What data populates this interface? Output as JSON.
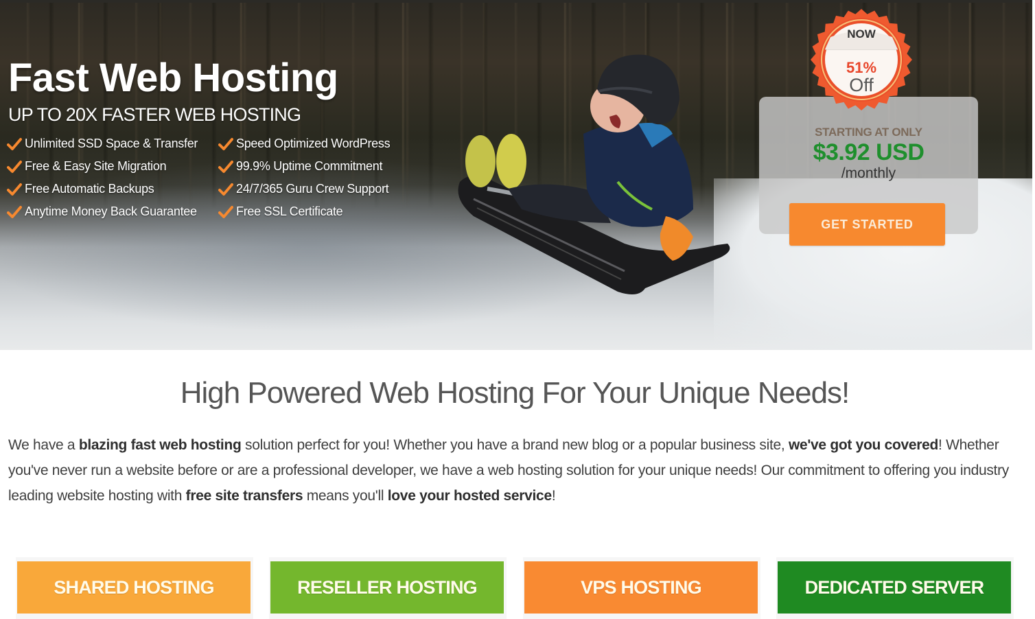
{
  "hero": {
    "title": "Fast Web Hosting",
    "subtitle": "UP TO 20X FASTER WEB HOSTING",
    "features": [
      "Unlimited SSD Space & Transfer",
      "Speed Optimized WordPress",
      "Free & Easy Site Migration",
      "99.9% Uptime Commitment",
      "Free Automatic Backups",
      "24/7/365 Guru Crew Support",
      "Anytime Money Back Guarantee",
      "Free SSL Certificate"
    ],
    "feature_icon": "checkmark-icon",
    "badge": {
      "line1": "NOW",
      "percent": "51%",
      "line3": "Off"
    },
    "price": {
      "label": "STARTING AT ONLY",
      "amount": "$3.92 USD",
      "period": "/monthly"
    },
    "cta_label": "GET STARTED"
  },
  "main": {
    "title": "High Powered Web Hosting For Your Unique Needs!",
    "intro": [
      {
        "text": "We have a ",
        "bold": false
      },
      {
        "text": "blazing fast web hosting",
        "bold": true
      },
      {
        "text": " solution perfect for you! Whether you have a brand new blog or a popular business site, ",
        "bold": false
      },
      {
        "text": "we've got you covered",
        "bold": true
      },
      {
        "text": "! Whether you've never run a website before or are a professional developer, we have a web hosting solution for your unique needs! Our commitment to offering you industry leading website hosting with ",
        "bold": false
      },
      {
        "text": "free site transfers",
        "bold": true
      },
      {
        "text": " means you'll ",
        "bold": false
      },
      {
        "text": "love your hosted service",
        "bold": true
      },
      {
        "text": "!",
        "bold": false
      }
    ]
  },
  "plans": [
    {
      "label": "SHARED HOSTING",
      "color": "#f9a83a"
    },
    {
      "label": "RESELLER HOSTING",
      "color": "#74b72d"
    },
    {
      "label": "VPS HOSTING",
      "color": "#f98a32"
    },
    {
      "label": "DEDICATED SERVER",
      "color": "#1f8a22"
    }
  ],
  "colors": {
    "accent_orange": "#f7892f",
    "price_green": "#1f8f2d",
    "badge_red": "#e8452a"
  }
}
